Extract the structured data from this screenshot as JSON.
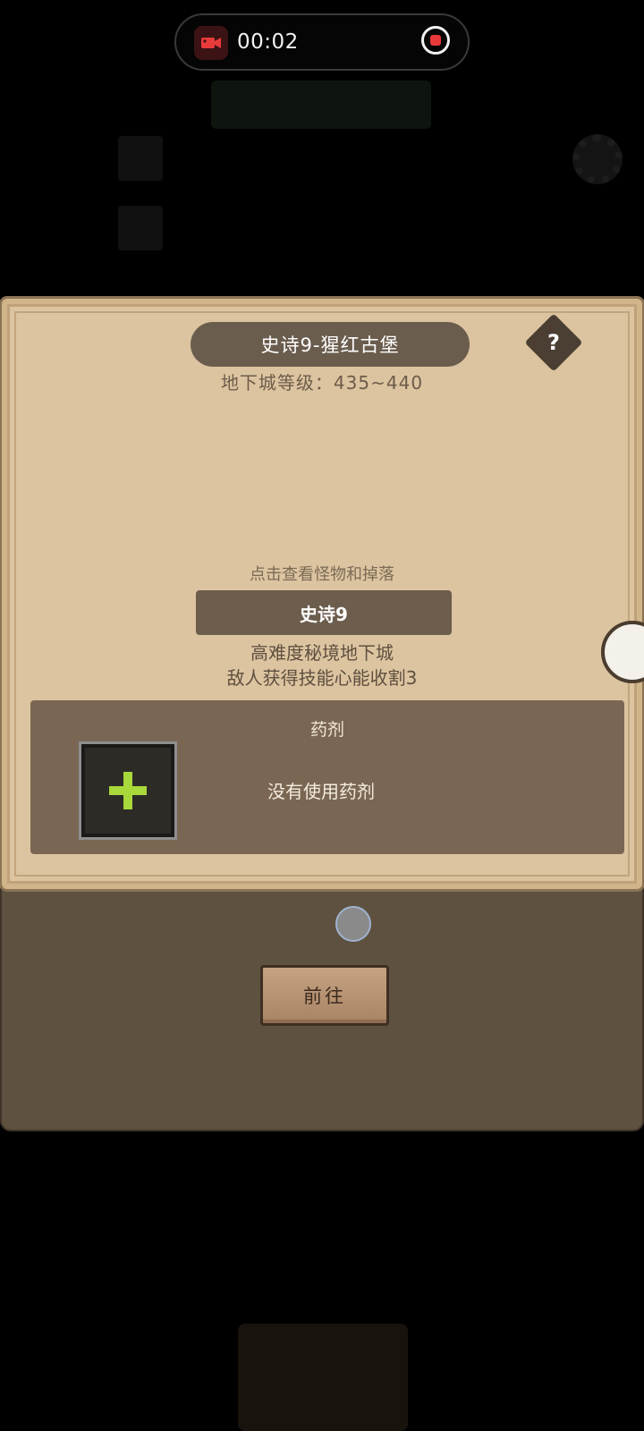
{
  "recording": {
    "time": "00:02"
  },
  "dialog": {
    "title": "史诗9-猩红古堡",
    "help_label": "?",
    "level_text": "地下城等级：435~440",
    "hint": "点击查看怪物和掉落",
    "difficulty_label": "史诗9",
    "description_line1": "高难度秘境地下城",
    "description_line2": "敌人获得技能心能收割3",
    "potion": {
      "title": "药剂",
      "status": "没有使用药剂"
    }
  },
  "lower_panel": {
    "go_label": "前往"
  },
  "colors": {
    "parchment": "#dcc4a0",
    "banner": "#6b5d4e",
    "potion_panel": "#7a6753",
    "plus_green": "#a8d83a"
  }
}
